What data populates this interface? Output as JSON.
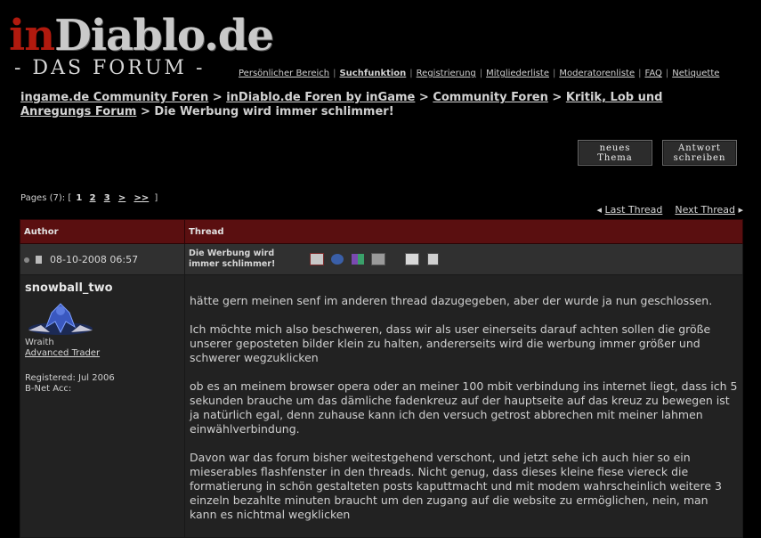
{
  "header": {
    "logo_in": "in",
    "logo_rest": "Diablo.de",
    "logo_sub": "- DAS FORUM -",
    "nav": [
      {
        "label": "Persönlicher Bereich",
        "bold": false
      },
      {
        "label": "Suchfunktion",
        "bold": true
      },
      {
        "label": "Registrierung",
        "bold": false
      },
      {
        "label": "Mitgliederliste",
        "bold": false
      },
      {
        "label": "Moderatorenliste",
        "bold": false
      },
      {
        "label": "FAQ",
        "bold": false
      },
      {
        "label": "Netiquette",
        "bold": false
      }
    ]
  },
  "breadcrumb": {
    "items": [
      "ingame.de Community Foren",
      "inDiablo.de Foren by inGame",
      "Community Foren",
      "Kritik, Lob und Anregungs Forum"
    ],
    "separator": ">",
    "current": "Die Werbung wird immer schlimmer!"
  },
  "buttons": {
    "new_thread": [
      "neues",
      "Thema"
    ],
    "reply": [
      "Antwort",
      "schreiben"
    ]
  },
  "pagination": {
    "label": "Pages (7):",
    "open": "[",
    "current": "1",
    "pages": [
      "2",
      "3",
      ">",
      ">>"
    ],
    "close": "]"
  },
  "thread_nav": {
    "prev": "Last Thread",
    "next": "Next Thread"
  },
  "table": {
    "col_author": "Author",
    "col_thread": "Thread"
  },
  "post": {
    "date": "08-10-2008 06:57",
    "title": "Die Werbung wird immer schlimmer!",
    "icons": [
      "email-icon",
      "profile-icon",
      "buddy-icon",
      "pm-icon",
      "quote-icon",
      "edit-icon"
    ],
    "author": {
      "name": "snowball_two",
      "rank": "Wraith",
      "title": "Advanced Trader",
      "registered": "Registered: Jul 2006",
      "bnet": "B-Net Acc:"
    },
    "paragraphs": [
      "hätte gern meinen senf im anderen thread dazugegeben, aber der wurde ja nun geschlossen.",
      "Ich möchte mich also beschweren, dass wir als user einerseits darauf achten sollen die größe unserer geposteten bilder klein zu halten, andererseits wird die werbung immer größer und schwerer wegzuklicken",
      "ob es an meinem browser opera oder an meiner 100 mbit verbindung ins internet liegt, dass ich 5 sekunden brauche um das dämliche fadenkreuz auf der hauptseite auf das kreuz zu bewegen ist ja natürlich egal, denn zuhause kann ich den versuch getrost abbrechen mit meiner lahmen einwählverbindung.",
      "Davon war das forum bisher weitestgehend verschont, und jetzt sehe ich auch hier so ein mieserables flashfenster in den threads. Nicht genug, dass dieses kleine fiese viereck die formatierung in schön gestalteten posts kaputtmacht und mit modem wahrscheinlich weitere 3 einzeln bezahlte minuten braucht um den zugang auf die website zu ermöglichen, nein, man kann es nichtmal wegklicken"
    ]
  }
}
